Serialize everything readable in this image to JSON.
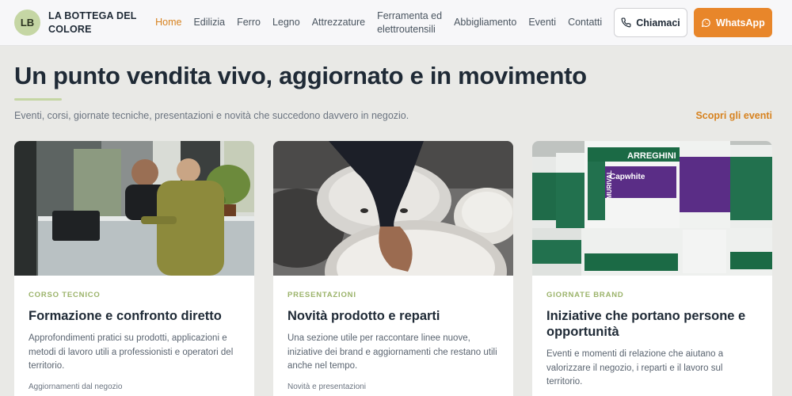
{
  "brand": {
    "initials": "LB",
    "name": "LA BOTTEGA DEL COLORE"
  },
  "nav": [
    {
      "label": "Home",
      "active": true
    },
    {
      "label": "Edilizia"
    },
    {
      "label": "Ferro"
    },
    {
      "label": "Legno"
    },
    {
      "label": "Attrezzature"
    },
    {
      "label": "Ferramenta ed elettroutensili"
    },
    {
      "label": "Abbigliamento"
    },
    {
      "label": "Eventi"
    },
    {
      "label": "Contatti"
    }
  ],
  "actions": {
    "call_label": "Chiamaci",
    "whatsapp_label": "WhatsApp"
  },
  "section": {
    "title": "Un punto vendita vivo, aggiornato e in movimento",
    "subtitle": "Eventi, corsi, giornate tecniche, presentazioni e novità che succedono davvero in negozio.",
    "link": "Scopri gli eventi"
  },
  "cards": [
    {
      "tag": "CORSO TECNICO",
      "title": "Formazione e confronto diretto",
      "text": "Approfondimenti pratici su prodotti, applicazioni e metodi di lavoro utili a professionisti e operatori del territorio.",
      "foot": "Aggiornamenti dal negozio"
    },
    {
      "tag": "PRESENTAZIONI",
      "title": "Novità prodotto e reparti",
      "text": "Una sezione utile per raccontare linee nuove, iniziative dei brand e aggiornamenti che restano utili anche nel tempo.",
      "foot": "Novità e presentazioni"
    },
    {
      "tag": "GIORNATE BRAND",
      "title": "Iniziative che portano persone e opportunità",
      "text": "Eventi e momenti di relazione che aiutano a valorizzare il negozio, i reparti e il lavoro sul territorio.",
      "foot": "",
      "photo_labels": {
        "brand": "ARREGHINI",
        "product": "Capwhite",
        "line": "MURIVAL"
      }
    }
  ],
  "colors": {
    "accent": "#e8862a",
    "accent_text": "#d7821f",
    "badge": "#c5d6a4",
    "tag": "#9bb36a"
  }
}
